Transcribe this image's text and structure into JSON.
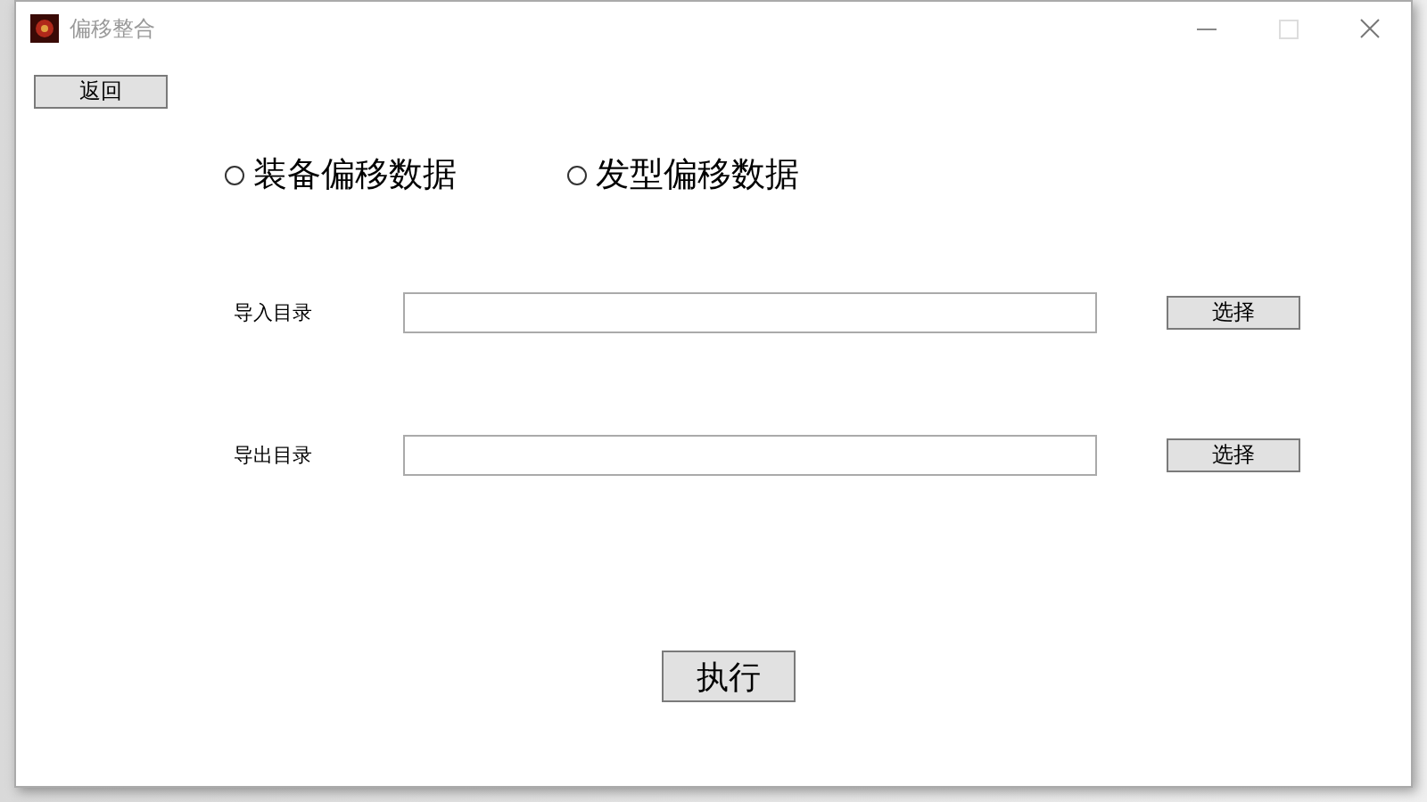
{
  "window": {
    "title": "偏移整合"
  },
  "back_button": "返回",
  "data_type": [
    {
      "label": "装备偏移数据",
      "selected": false
    },
    {
      "label": "发型偏移数据",
      "selected": false
    }
  ],
  "directories": [
    {
      "label": "导入目录",
      "button": "选择"
    },
    {
      "label": "导出目录",
      "button": "选择"
    }
  ],
  "run_button": "执行"
}
